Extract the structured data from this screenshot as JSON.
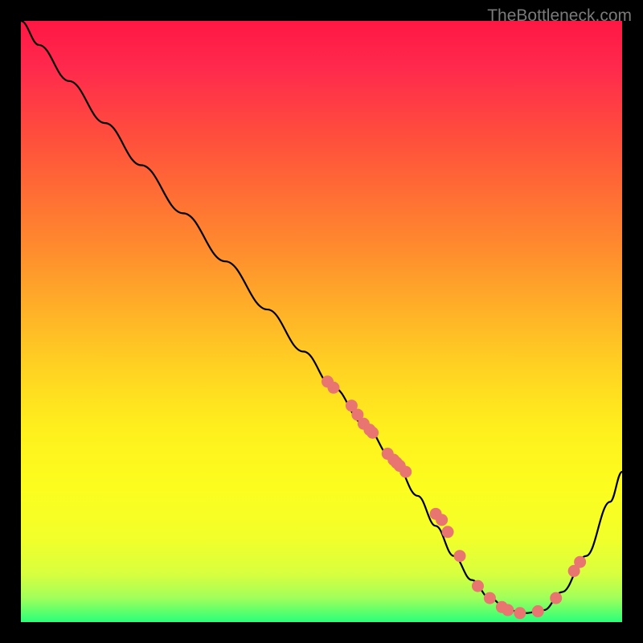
{
  "watermark": "TheBottleneck.com",
  "chart_data": {
    "type": "line",
    "title": "",
    "xlabel": "",
    "ylabel": "",
    "xlim": [
      0,
      100
    ],
    "ylim": [
      0,
      100
    ],
    "series": [
      {
        "name": "bottleneck-curve",
        "x": [
          0,
          3,
          8,
          14,
          20,
          27,
          34,
          41,
          47,
          52,
          57,
          62,
          66,
          69,
          72,
          75,
          78,
          81,
          84,
          87,
          90,
          94,
          98,
          100
        ],
        "y": [
          100,
          96,
          90,
          83,
          76,
          68,
          60,
          52,
          45,
          39,
          33,
          27,
          21,
          16,
          11,
          7,
          4,
          2,
          1.5,
          2,
          5,
          11,
          20,
          25
        ]
      }
    ],
    "scatter_points": {
      "name": "data-dots",
      "x": [
        51,
        52,
        55,
        56,
        57,
        58,
        58.5,
        61,
        62,
        62.5,
        63,
        64,
        69,
        70,
        71,
        73,
        76,
        78,
        80,
        81,
        83,
        86,
        89,
        92,
        93
      ],
      "y": [
        40,
        39,
        36,
        34.5,
        33,
        32,
        31.5,
        28,
        27,
        26.5,
        26,
        25,
        18,
        17,
        15,
        11,
        6,
        4,
        2.5,
        2,
        1.5,
        1.8,
        4,
        8.5,
        10
      ]
    },
    "gradient_colors": {
      "top": "#ff1744",
      "middle": "#ffd322",
      "bottom": "#2aff7a"
    }
  }
}
